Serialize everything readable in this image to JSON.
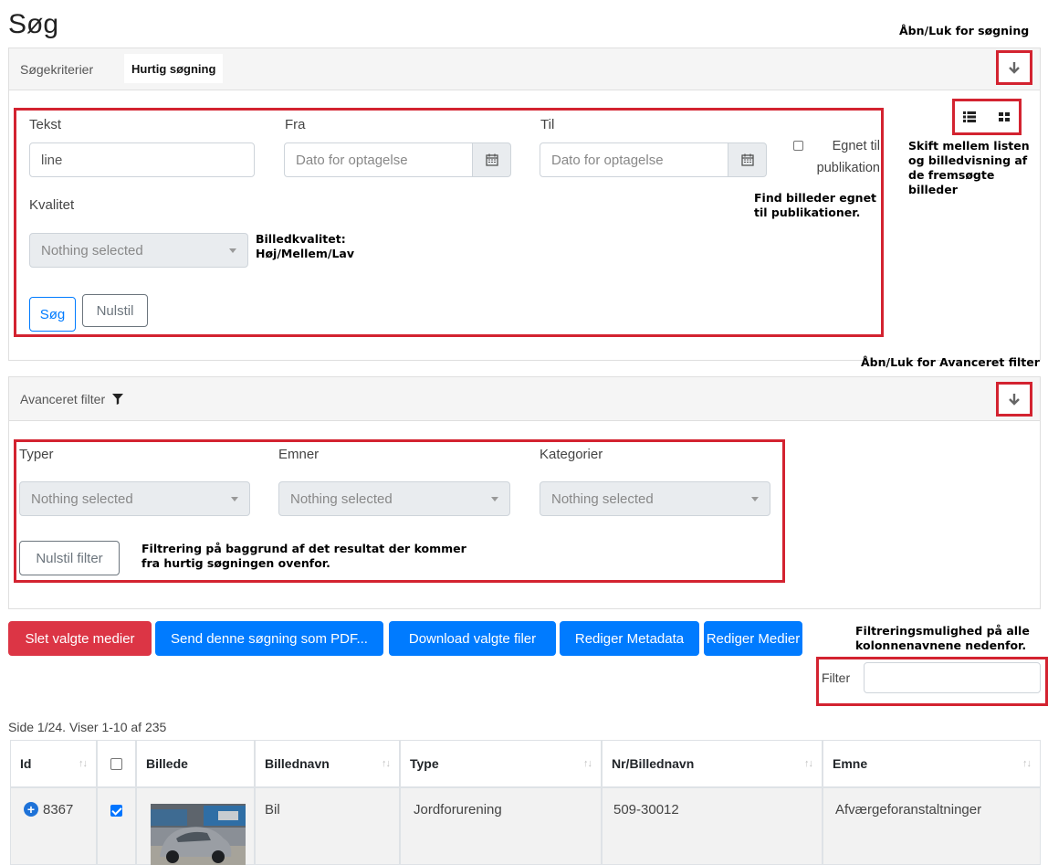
{
  "page": {
    "title": "Søg"
  },
  "notes": {
    "toggle_search": "Åbn/Luk for søgning",
    "view_switch": "Skift mellem listen og billedvisning af de fremsøgte billeder",
    "publication": "Find billeder egnet til publikationer.",
    "quality": "Billedkvalitet: Høj/Mellem/Lav",
    "toggle_advanced": "Åbn/Luk for Avanceret filter",
    "filter_explain": "Filtrering på baggrund af det resultat der kommer fra hurtig søgningen ovenfor.",
    "column_filter": "Filtreringsmulighed på alle kolonnenavnene nedenfor."
  },
  "search_panel": {
    "header_label": "Søgekriterier",
    "tab_active": "Hurtig søgning",
    "text_label": "Tekst",
    "text_value": "line",
    "from_label": "Fra",
    "from_placeholder": "Dato for optagelse",
    "to_label": "Til",
    "to_placeholder": "Dato for optagelse",
    "publication_label": "Egnet til publikation",
    "quality_label": "Kvalitet",
    "quality_value": "Nothing selected",
    "search_button": "Søg",
    "reset_button": "Nulstil"
  },
  "advanced_panel": {
    "header_label": "Avanceret filter",
    "types_label": "Typer",
    "types_value": "Nothing selected",
    "subjects_label": "Emner",
    "subjects_value": "Nothing selected",
    "categories_label": "Kategorier",
    "categories_value": "Nothing selected",
    "reset_filter_button": "Nulstil filter"
  },
  "actions": {
    "delete": "Slet valgte medier",
    "send_pdf": "Send denne søgning som PDF...",
    "download": "Download valgte filer",
    "edit_metadata": "Rediger Metadata",
    "edit_media": "Rediger Medier"
  },
  "filter": {
    "label": "Filter",
    "value": ""
  },
  "results": {
    "summary": "Side 1/24. Viser 1-10 af 235",
    "columns": [
      "Id",
      "",
      "Billede",
      "Billednavn",
      "Type",
      "Nr/Billednavn",
      "Emne"
    ],
    "rows": [
      {
        "id": "8367",
        "checked": true,
        "name": "Bil",
        "type": "Jordforurening",
        "nr": "509-30012",
        "subject": "Afværgeforanstaltninger"
      }
    ]
  },
  "colors": {
    "primary": "#007bff",
    "danger": "#dc3545",
    "annotation_red": "#d32330"
  }
}
